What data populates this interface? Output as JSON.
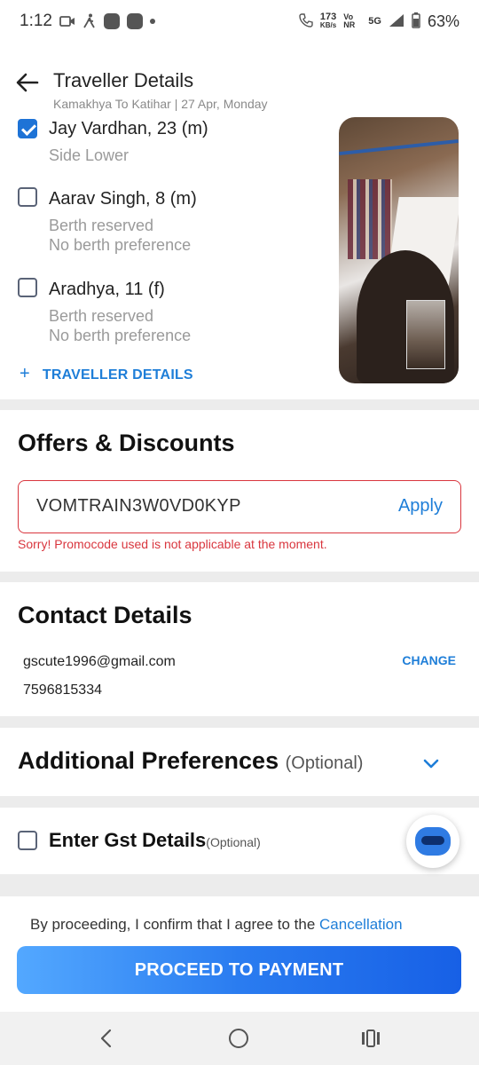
{
  "status_bar": {
    "time": "1:12",
    "network_speed": "173",
    "network_speed_unit": "KB/s",
    "volte": "Vo NR",
    "network": "5G",
    "battery": "63%"
  },
  "header": {
    "title": "Traveller Details",
    "subtitle": "Kamakhya To Katihar | 27 Apr, Monday"
  },
  "travellers": [
    {
      "name": "Jay Vardhan, 23 (m)",
      "checked": true,
      "lines": [
        "Side Lower"
      ]
    },
    {
      "name": "Aarav Singh, 8 (m)",
      "checked": false,
      "lines": [
        "Berth reserved",
        "No berth preference"
      ]
    },
    {
      "name": "Aradhya, 11 (f)",
      "checked": false,
      "lines": [
        "Berth reserved",
        "No berth preference"
      ]
    }
  ],
  "add_traveller": {
    "plus": "+",
    "label": "TRAVELLER DETAILS"
  },
  "offers": {
    "title": "Offers & Discounts",
    "promo_code": "VOMTRAIN3W0VD0KYP",
    "apply_label": "Apply",
    "error": "Sorry! Promocode used is not applicable at the moment."
  },
  "contact": {
    "title": "Contact Details",
    "email": "gscute1996@gmail.com",
    "phone": "7596815334",
    "change_label": "CHANGE"
  },
  "additional_preferences": {
    "title": "Additional Preferences",
    "optional": "(Optional)"
  },
  "gst": {
    "label": "Enter Gst Details",
    "optional": "(Optional)"
  },
  "consent": {
    "text": "By proceeding, I confirm that I agree to the",
    "link": "Cancellation"
  },
  "proceed_label": "PROCEED TO PAYMENT",
  "colors": {
    "accent": "#1e7ed8",
    "error": "#d9363e",
    "button_start": "#53a8ff",
    "button_end": "#1760e6"
  }
}
